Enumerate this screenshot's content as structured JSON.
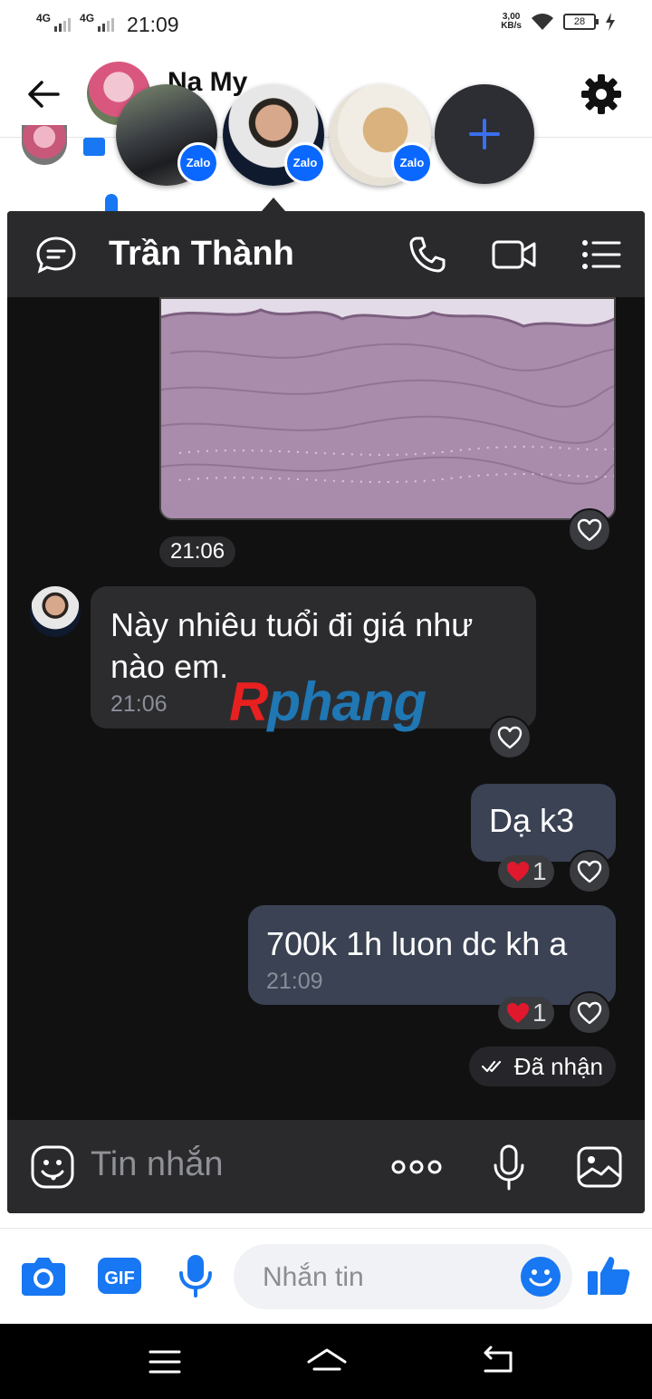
{
  "status_bar": {
    "sim1": "4G",
    "sim2": "4G",
    "time": "21:09",
    "speed_value": "3,00",
    "speed_unit": "KB/s",
    "battery": "28"
  },
  "messenger": {
    "header_name": "Na My",
    "icons": [
      "back-arrow-icon",
      "gear-icon"
    ]
  },
  "chat_heads": {
    "badge_label": "Zalo",
    "add_icon": "plus-icon"
  },
  "chat": {
    "contact_name": "Trần Thành",
    "header_icons": [
      "chat-bubble-icon",
      "phone-icon",
      "video-camera-icon",
      "list-menu-icon"
    ],
    "image_time": "21:06",
    "messages": [
      {
        "direction": "in",
        "text": "Này nhiêu tuổi đi giá như nào em.",
        "time": "21:06"
      },
      {
        "direction": "out",
        "text": "Dạ k3",
        "reaction_count": "1"
      },
      {
        "direction": "out",
        "text": "700k 1h luon dc kh a",
        "time": "21:09",
        "reaction_count": "1"
      }
    ],
    "delivery_status": "Đã nhận",
    "watermark": {
      "part1": "R",
      "part2": "phang"
    },
    "composer_placeholder": "Tin nhắn",
    "colors": {
      "panel": "#111112",
      "header": "#2a2a2d",
      "bubble_in": "#2c2c2f",
      "bubble_out": "#3a4254"
    }
  },
  "bottom_bar": {
    "placeholder": "Nhắn tin",
    "gif_label": "GIF",
    "accent": "#1877f2",
    "icons": [
      "camera-icon",
      "gif-icon",
      "microphone-icon",
      "emoji-icon",
      "like-icon"
    ]
  }
}
